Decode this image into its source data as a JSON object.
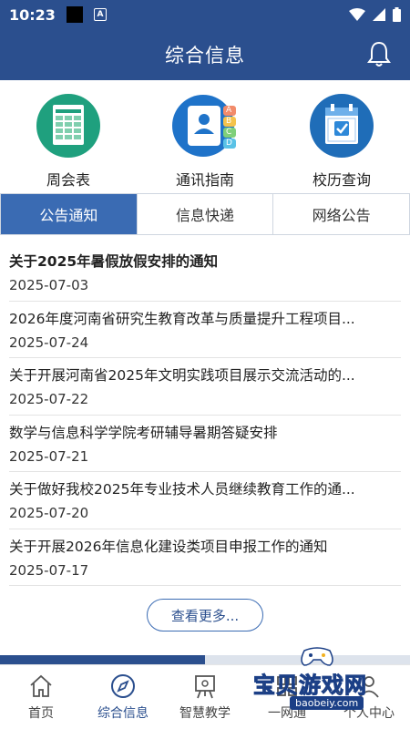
{
  "status_bar": {
    "time": "10:23",
    "a_badge": "A"
  },
  "header": {
    "title": "综合信息"
  },
  "quick_links": [
    {
      "label": "周会表",
      "icon": "spreadsheet-icon"
    },
    {
      "label": "通讯指南",
      "icon": "contacts-icon"
    },
    {
      "label": "校历查询",
      "icon": "calendar-icon"
    }
  ],
  "contacts_letters": [
    "A",
    "B",
    "C",
    "D"
  ],
  "tabs": [
    {
      "label": "公告通知",
      "active": true
    },
    {
      "label": "信息快递",
      "active": false
    },
    {
      "label": "网络公告",
      "active": false
    }
  ],
  "notices": [
    {
      "title": "关于2025年暑假放假安排的通知",
      "date": "2025-07-03"
    },
    {
      "title": "2026年度河南省研究生教育改革与质量提升工程项目...",
      "date": "2025-07-24"
    },
    {
      "title": "关于开展河南省2025年文明实践项目展示交流活动的...",
      "date": "2025-07-22"
    },
    {
      "title": "数学与信息科学学院考研辅导暑期答疑安排",
      "date": "2025-07-21"
    },
    {
      "title": "关于做好我校2025年专业技术人员继续教育工作的通...",
      "date": "2025-07-20"
    },
    {
      "title": "关于开展2026年信息化建设类项目申报工作的通知",
      "date": "2025-07-17"
    }
  ],
  "more_button": "查看更多...",
  "progress": {
    "fraction": 0.5
  },
  "bottom_nav": [
    {
      "label": "首页",
      "icon": "home-icon"
    },
    {
      "label": "综合信息",
      "icon": "compass-icon",
      "active": true
    },
    {
      "label": "智慧教学",
      "icon": "easel-icon"
    },
    {
      "label": "一网通",
      "icon": "grid-icon"
    },
    {
      "label": "个人中心",
      "icon": "person-icon"
    }
  ],
  "watermark": {
    "text": "宝贝游戏网",
    "url": "baobeiy.com"
  },
  "colors": {
    "primary": "#2b4f8e",
    "tab_active": "#3a6bb3",
    "watermark": "#f2b01e"
  }
}
